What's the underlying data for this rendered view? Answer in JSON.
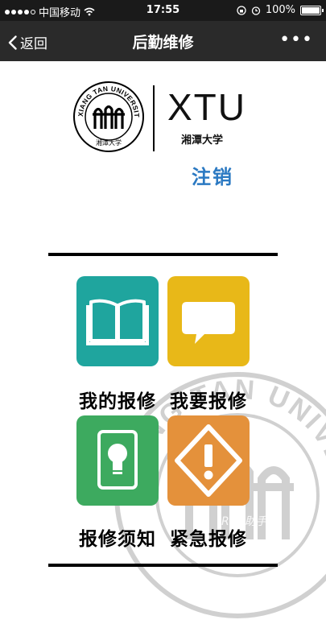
{
  "status": {
    "carrier": "中国移动",
    "time": "17:55",
    "battery": "100%",
    "battery_level": 1.0
  },
  "nav": {
    "back_label": "返回",
    "title": "后勤维修",
    "more": "•••"
  },
  "logo": {
    "seal_text": "XIANG TAN UNIVERSITY",
    "seal_bottom": "湘潭大学",
    "short": "XTU",
    "cn": "湘潭大学"
  },
  "logout_label": "注销",
  "tiles": [
    {
      "label": "我的报修",
      "color": "#1fa59e",
      "icon": "book-icon"
    },
    {
      "label": "我要报修",
      "color": "#e8b818",
      "icon": "speech-bubble-icon"
    },
    {
      "label": "报修须知",
      "color": "#3daa5f",
      "icon": "lightbulb-icon"
    },
    {
      "label": "紧急报修",
      "color": "#e4913b",
      "icon": "warning-icon"
    }
  ],
  "corner_mark": "RoN助手"
}
